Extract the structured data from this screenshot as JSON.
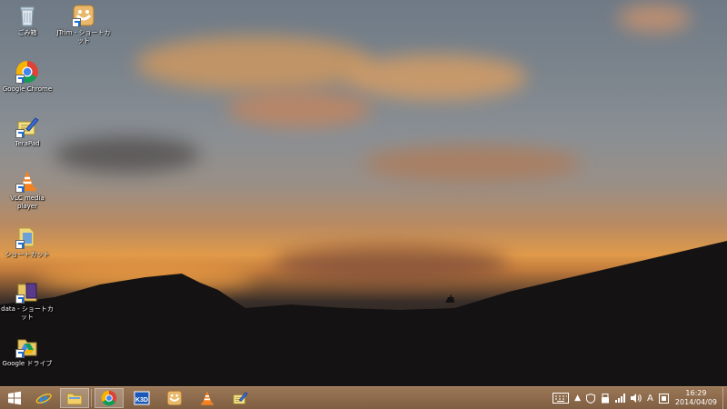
{
  "desktop_icons": [
    {
      "label": "ごみ箱",
      "icon": "recycle-bin-icon"
    },
    {
      "label": "JTrim - ショートカット",
      "icon": "jtrim-icon"
    },
    {
      "label": "Google Chrome",
      "icon": "chrome-icon"
    },
    {
      "label": "TeraPad",
      "icon": "terapad-icon"
    },
    {
      "label": "VLC media player",
      "icon": "vlc-icon"
    },
    {
      "label": "ショートカット",
      "icon": "folder-shortcut-icon"
    },
    {
      "label": "data - ショートカット",
      "icon": "data-folder-icon"
    },
    {
      "label": "Google ドライブ",
      "icon": "google-drive-icon"
    }
  ],
  "taskbar": {
    "pinned": [
      {
        "name": "start",
        "icon": "windows-logo-icon"
      },
      {
        "name": "internet-explorer",
        "icon": "ie-icon"
      },
      {
        "name": "file-explorer",
        "icon": "folder-icon"
      },
      {
        "name": "chrome",
        "icon": "chrome-icon"
      },
      {
        "name": "k3d",
        "icon": "k3d-icon"
      },
      {
        "name": "jtrim",
        "icon": "jtrim-icon"
      },
      {
        "name": "vlc",
        "icon": "vlc-icon"
      },
      {
        "name": "terapad",
        "icon": "terapad-icon"
      }
    ],
    "k3d_label": "K3D",
    "tray": {
      "ime_mode": "A",
      "time": "16:29",
      "date": "2014/04/09"
    }
  },
  "colors": {
    "taskbar": "#8a6a4a",
    "sky_orange": "#e09a4a",
    "ridge": "#141212"
  }
}
